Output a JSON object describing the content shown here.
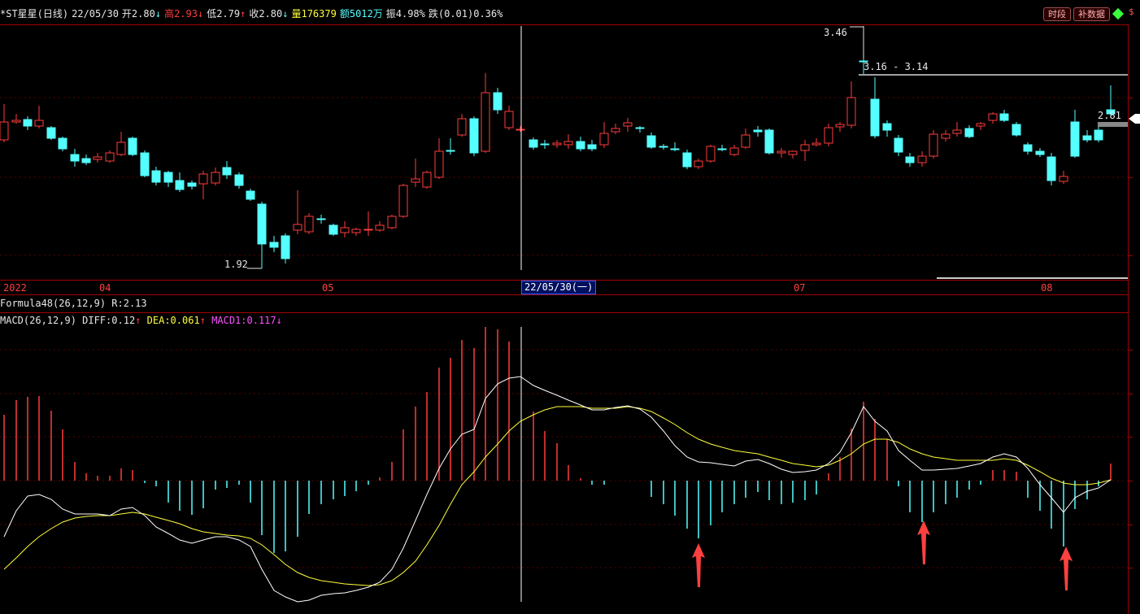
{
  "header": {
    "title": "*ST星星(日线)",
    "date": "22/05/30",
    "open": "开2.80",
    "open_arrow": "↓",
    "high": "高2.93",
    "high_arrow": "↓",
    "low": "低2.79",
    "low_arrow": "↑",
    "close": "收2.80",
    "close_arrow": "↓",
    "volume": "量176379",
    "amount": "额5012万",
    "amplitude": "振4.98%",
    "change": "跌(0.01)0.36%"
  },
  "buttons": {
    "time_segment": "时段",
    "supplement_data": "补数据"
  },
  "price_labels": {
    "high_peak": "3.46",
    "range": "3.16 - 3.14",
    "low_trough": "1.92",
    "current": "2.81"
  },
  "date_axis": {
    "labels": [
      "2022",
      "04",
      "05",
      "07",
      "08"
    ],
    "cursor_date": "22/05/30(一)"
  },
  "formula_line": "Formula48(26,12,9) R:2.13",
  "macd": {
    "name": "MACD(26,12,9)",
    "diff": "DIFF:0.12",
    "diff_arrow": "↑",
    "dea": "DEA:0.061",
    "dea_arrow": "↑",
    "macd1": "MACD1:0.117",
    "macd1_arrow": "↓"
  },
  "colors": {
    "up": "#ff3c3c",
    "down": "#54ffff",
    "dea_line": "#ffff3c",
    "diff_line": "#ffffff",
    "arrow": "#ff4040"
  },
  "icons": {
    "status": "green-diamond-icon",
    "dollar": "dollar-icon",
    "annotation": "red-up-arrow-icon"
  }
}
